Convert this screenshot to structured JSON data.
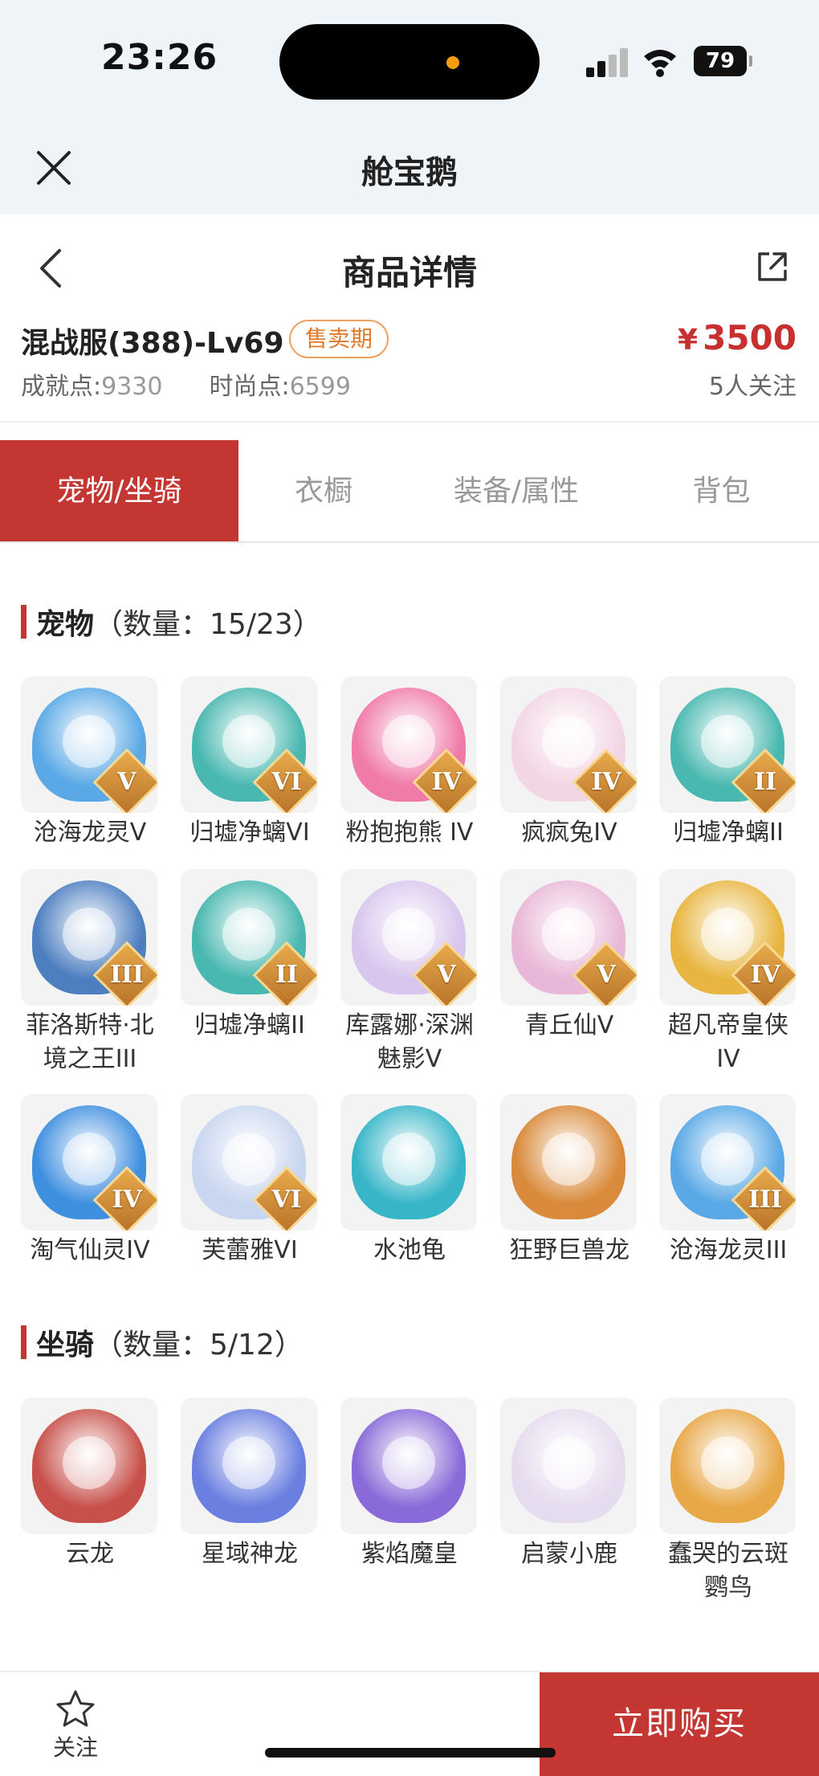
{
  "status_bar": {
    "time": "23:26",
    "battery": "79"
  },
  "app": {
    "title": "舱宝鹅",
    "close_icon": "close-icon"
  },
  "nav": {
    "title": "商品详情",
    "back_icon": "chevron-left-icon",
    "share_icon": "share-icon"
  },
  "product": {
    "server": "混战服(388)-Lv69",
    "badge": "售卖期",
    "price_symbol": "¥",
    "price": "3500",
    "achievement_label": "成就点:",
    "achievement_value": "9330",
    "fashion_label": "时尚点:",
    "fashion_value": "6599",
    "followers": "5人关注"
  },
  "tabs": [
    {
      "label": "宠物/坐骑",
      "active": true
    },
    {
      "label": "衣橱",
      "active": false
    },
    {
      "label": "装备/属性",
      "active": false
    },
    {
      "label": "背包",
      "active": false
    }
  ],
  "pets": {
    "title": "宠物",
    "count": "（数量：15/23）",
    "items": [
      {
        "name": "沧海龙灵V",
        "rank": "V",
        "color": "#5aa9e6"
      },
      {
        "name": "归墟净螭VI",
        "rank": "VI",
        "color": "#49b8b0"
      },
      {
        "name": "粉抱抱熊 IV",
        "rank": "IV",
        "color": "#f07aa8"
      },
      {
        "name": "疯疯兔IV",
        "rank": "IV",
        "color": "#f3d6e4"
      },
      {
        "name": "归墟净螭II",
        "rank": "II",
        "color": "#49b8b0"
      },
      {
        "name": "菲洛斯特·北境之王III",
        "rank": "III",
        "color": "#4d7fc0"
      },
      {
        "name": "归墟净螭II",
        "rank": "II",
        "color": "#49b8b0"
      },
      {
        "name": "库露娜·深渊魅影V",
        "rank": "V",
        "color": "#d9c6ee"
      },
      {
        "name": "青丘仙V",
        "rank": "V",
        "color": "#e9b8d8"
      },
      {
        "name": "超凡帝皇侠IV",
        "rank": "IV",
        "color": "#e8b640"
      },
      {
        "name": "淘气仙灵IV",
        "rank": "IV",
        "color": "#3f8fe0"
      },
      {
        "name": "芙蕾雅VI",
        "rank": "VI",
        "color": "#c9d6f0"
      },
      {
        "name": "水池龟",
        "rank": "",
        "color": "#38b6c8"
      },
      {
        "name": "狂野巨兽龙",
        "rank": "",
        "color": "#d98a3a"
      },
      {
        "name": "沧海龙灵III",
        "rank": "III",
        "color": "#5aa9e6"
      }
    ]
  },
  "mounts": {
    "title": "坐骑",
    "count": "（数量：5/12）",
    "items": [
      {
        "name": "云龙",
        "color": "#c8504a"
      },
      {
        "name": "星域神龙",
        "color": "#6a7fe0"
      },
      {
        "name": "紫焰魔皇",
        "color": "#8a6ad8"
      },
      {
        "name": "启蒙小鹿",
        "color": "#e6dcef"
      },
      {
        "name": "蠢哭的云斑鹦鸟",
        "color": "#e8a848"
      }
    ]
  },
  "bottom": {
    "follow_label": "关注",
    "follow_icon": "star-icon",
    "buy_label": "立即购买"
  }
}
